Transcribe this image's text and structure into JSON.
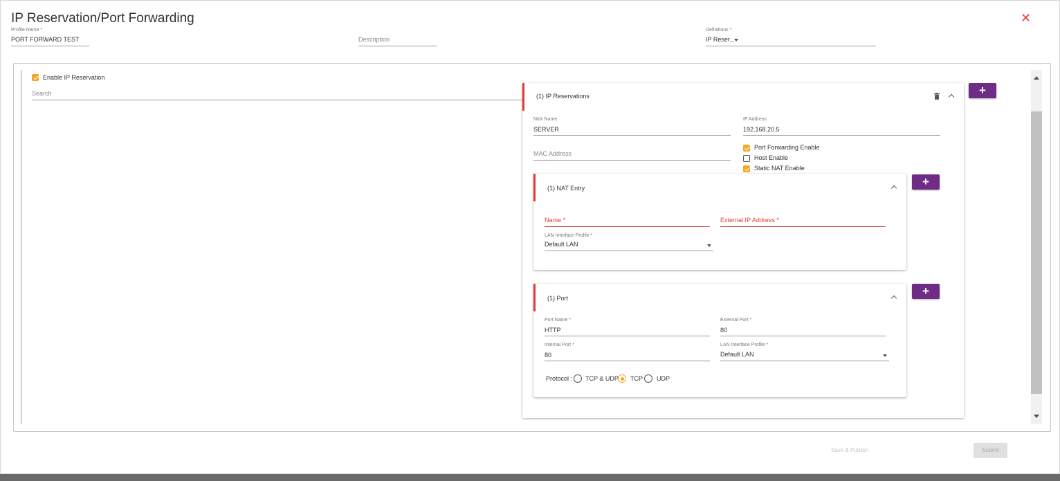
{
  "dialog": {
    "title": "IP Reservation/Port Forwarding",
    "close_icon": "close-icon"
  },
  "header": {
    "profile_name_label": "Profile Name *",
    "profile_name_value": "PORT FORWARD TEST",
    "description_placeholder": "Description",
    "definitions_label": "Definitions *",
    "definitions_value": "IP Reser..."
  },
  "left": {
    "enable_ip_reservation_label": "Enable IP Reservation",
    "enable_ip_reservation_checked": true,
    "search_placeholder": "Search"
  },
  "ip_reservation_card": {
    "title": "(1) IP Reservations",
    "nick_name_label": "Nick Name",
    "nick_name_value": "SERVER",
    "ip_address_label": "IP Address",
    "ip_address_value": "192.168.20.5",
    "mac_address_placeholder": "MAC Address",
    "port_forwarding_enable_label": "Port Forwarding Enable",
    "host_enable_label": "Host Enable",
    "static_nat_enable_label": "Static NAT Enable",
    "port_forwarding_enable_checked": true,
    "host_enable_checked": false,
    "static_nat_enable_checked": true
  },
  "nat_card": {
    "title": "(1) NAT Entry",
    "name_label": "Name *",
    "external_ip_label": "External IP Address *",
    "lan_interface_label": "LAN Interface Profile *",
    "lan_interface_value": "Default LAN"
  },
  "port_card": {
    "title": "(1) Port",
    "port_name_label": "Port Name *",
    "port_name_value": "HTTP",
    "external_port_label": "External Port *",
    "external_port_value": "80",
    "internal_port_label": "Internal Port *",
    "internal_port_value": "80",
    "lan_interface_label": "LAN Interface Profile *",
    "lan_interface_value": "Default LAN",
    "protocol_label": "Protocol :",
    "protocol_options": [
      "TCP & UDP",
      "TCP",
      "UDP"
    ],
    "protocol_selected": "TCP"
  },
  "buttons": {
    "add_symbol": "+"
  },
  "footer": {
    "save_publish_label": "Save & Publish",
    "submit_label": "Submit"
  },
  "colors": {
    "accent_purple": "#6f2c86",
    "checkbox_orange": "#f5a623",
    "error_red": "#e53935"
  }
}
